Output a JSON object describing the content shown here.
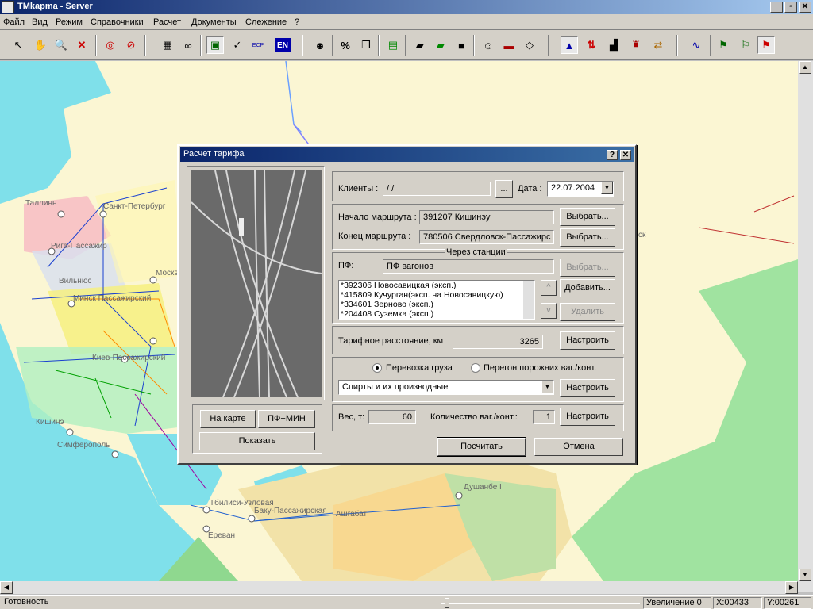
{
  "window": {
    "title": "TMkapma - Server",
    "min": "_",
    "max": "▫",
    "close": "✕"
  },
  "menu": [
    "Файл",
    "Вид",
    "Режим",
    "Справочники",
    "Расчет",
    "Документы",
    "Слежение",
    "?"
  ],
  "toolbar": {
    "icons": [
      "pointer-icon",
      "hand-icon",
      "zoom-icon",
      "close-red-icon",
      "target-icon",
      "compass-icon",
      "properties-icon",
      "binoculars-icon",
      "select-icon",
      "route-icon",
      "ecp-icon",
      "en-icon",
      "person-icon",
      "percent-icon",
      "copy-icon",
      "money-icon",
      "book-icon",
      "books-icon",
      "cube-icon",
      "user-icon",
      "tools-icon",
      "stamp-icon",
      "triangle-icon",
      "updown-icon",
      "locomotive-icon",
      "tower-icon",
      "exchange-icon",
      "graph-icon",
      "flag-icon",
      "flag2-icon",
      "pin-icon"
    ],
    "en_label": "EN",
    "ecp_label": "ECP",
    "percent_label": "%"
  },
  "map": {
    "cities": [
      "Таллинн",
      "Санкт-Петербург",
      "Рига-Пассажир",
      "Вильнюс",
      "Минск Пассажирский",
      "Москв",
      "Киев-Пассажирский",
      "Кишинэ",
      "Симферополь",
      "Тбилиси-Узловая",
      "Баку-Пассажирская",
      "Ашгабат",
      "Душанбе I",
      "Ереван",
      "ск"
    ]
  },
  "dialog": {
    "title": "Расчет тарифа",
    "help": "?",
    "close": "✕",
    "buttons": {
      "map": "На карте",
      "pfmin": "ПФ+МИН",
      "show": "Показать"
    },
    "clients_label": "Клиенты :",
    "clients_value": " / /",
    "browse": "...",
    "date_label": "Дата :",
    "date_value": "22.07.2004",
    "start_label": "Начало маршрута :",
    "start_value": "391207  Кишинэу",
    "end_label": "Конец   маршрута :",
    "end_value": "780506  Свердловск-Пассажирс",
    "select": "Выбрать...",
    "via_label": "Через станции",
    "pf_label": "ПФ:",
    "pf_value": "ПФ вагонов",
    "via_stations": [
      "*392306  Новосавицкая (эксп.)",
      "*415809  Кучурган(эксп. на Новосавицкую)",
      "*334601  Зерново (эксп.)",
      "*204408  Суземка (эксп.)"
    ],
    "up": "^",
    "down": "v",
    "add": "Добавить...",
    "delete": "Удалить",
    "distance_label": "Тарифное расстояние, км",
    "distance_value": "3265",
    "configure": "Настроить",
    "radio_cargo": "Перевозка груза",
    "radio_empty": "Перегон порожних ваг./конт.",
    "cargo_value": "Спирты и их производные",
    "weight_label": "Вес, т:",
    "weight_value": "60",
    "count_label": "Количество ваг./конт.:",
    "count_value": "1",
    "calc": "Посчитать",
    "cancel": "Отмена"
  },
  "status": {
    "ready": "Готовность",
    "zoom": "Увеличение 0",
    "x": "X:00433",
    "y": "Y:00261"
  }
}
